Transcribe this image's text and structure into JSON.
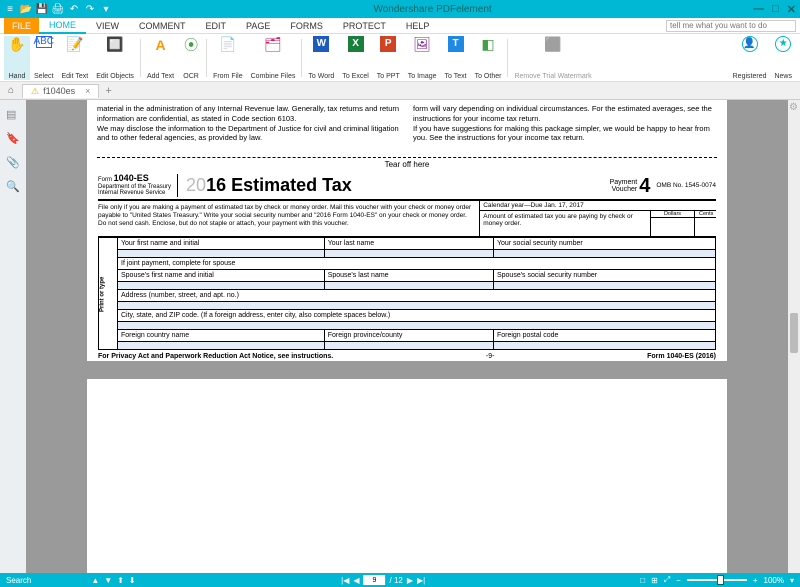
{
  "app": {
    "title": "Wondershare PDFelement"
  },
  "window": {
    "min": "—",
    "max": "□",
    "close": "✕"
  },
  "menu": {
    "file": "FILE",
    "items": [
      "HOME",
      "VIEW",
      "COMMENT",
      "EDIT",
      "PAGE",
      "FORMS",
      "PROTECT",
      "HELP"
    ],
    "active": "HOME",
    "search_placeholder": "tell me what you want to do"
  },
  "ribbon": {
    "groups": [
      {
        "icon": "✋",
        "label": "Hand",
        "color": "#00b8d4"
      },
      {
        "icon": "⬚",
        "label": "Select",
        "color": "#2962ff"
      },
      {
        "icon": "📝",
        "label": "Edit Text",
        "color": "#555"
      },
      {
        "icon": "🔲",
        "label": "Edit Objects",
        "color": "#555"
      }
    ],
    "groups2": [
      {
        "icon": "A",
        "label": "Add Text",
        "color": "#ff9800"
      },
      {
        "icon": "👁",
        "label": "OCR",
        "color": "#43a047"
      }
    ],
    "groups3": [
      {
        "icon": "📄",
        "label": "From File",
        "color": "#1e88e5"
      },
      {
        "icon": "🗂",
        "label": "Combine Files",
        "color": "#d81b60"
      }
    ],
    "groups4": [
      {
        "icon": "W",
        "label": "To Word",
        "color": "#1e5bbf"
      },
      {
        "icon": "X",
        "label": "To Excel",
        "color": "#1b7e3c"
      },
      {
        "icon": "P",
        "label": "To PPT",
        "color": "#d04423"
      },
      {
        "icon": "🖼",
        "label": "To Image",
        "color": "#7b1fa2"
      },
      {
        "icon": "T",
        "label": "To Text",
        "color": "#1e88e5"
      },
      {
        "icon": "⋯",
        "label": "To Other",
        "color": "#43a047"
      }
    ],
    "groups5": [
      {
        "icon": "⬛",
        "label": "Remove Trial Watermark",
        "color": "#bbb"
      }
    ],
    "right": [
      {
        "icon": "👤",
        "label": "Registered",
        "color": "#00b8d4"
      },
      {
        "icon": "★",
        "label": "News",
        "color": "#00b8d4"
      }
    ]
  },
  "tabs": {
    "home_icon": "⌂",
    "doc_icon": "⚠",
    "doc_name": "f1040es",
    "close": "×",
    "add": "+"
  },
  "doc": {
    "top_left": "material in the administration of any Internal Revenue law. Generally, tax returns and return information are confidential, as stated in Code section 6103.\n   We may disclose the information to the Department of Justice for civil and criminal litigation and to other federal agencies, as provided by law.",
    "top_right": "form will vary depending on individual circumstances. For the estimated averages, see the instructions for your income tax return.\n   If you have suggestions for making this package simpler, we would be happy to hear from you. See the instructions for your income tax return.",
    "tearoff": "Tear off here",
    "header": {
      "form_word": "Form",
      "form_no": "1040-ES",
      "dept": "Department of the Treasury",
      "irs": "Internal Revenue Service",
      "year_light": "20",
      "year_bold": "16",
      "title_rest": " Estimated Tax",
      "payment": "Payment",
      "voucher": "Voucher",
      "voucher_no": "4",
      "omb": "OMB No. 1545-0074"
    },
    "calendar": "Calendar year—Due Jan. 17, 2017",
    "instructions": "File only if you are making a payment of estimated tax by check or money order. Mail this voucher with your check or money order payable to \"United States Treasury.\" Write your social security number and \"2016 Form 1040-ES\" on your check or money order. Do not send cash. Enclose, but do not staple or attach, your payment with this voucher.",
    "amount_label": "Amount of estimated tax you are paying by check or money order.",
    "dollars": "Dollars",
    "cents": "Cents",
    "side": "Print or type",
    "rows": {
      "r1a": "Your first name and initial",
      "r1b": "Your last name",
      "r1c": "Your social security number",
      "r2": "If joint payment, complete for spouse",
      "r3a": "Spouse's first name and initial",
      "r3b": "Spouse's last name",
      "r3c": "Spouse's social security number",
      "r4": "Address (number, street, and apt. no.)",
      "r5": "City, state, and ZIP code. (If a foreign address, enter city, also complete spaces below.)",
      "r6a": "Foreign country name",
      "r6b": "Foreign province/county",
      "r6c": "Foreign postal code"
    },
    "footer_left": "For Privacy Act and Paperwork Reduction Act Notice, see instructions.",
    "footer_mid": "-9-",
    "footer_right": "Form 1040-ES (2016)"
  },
  "status": {
    "left": "Search",
    "nav_icons": [
      "▲",
      "▼",
      "⬆",
      "⬇"
    ],
    "first": "|◀",
    "prev": "◀",
    "page": "9",
    "total": "/ 12",
    "next": "▶",
    "last": "▶|",
    "view_icons": [
      "□",
      "⊞",
      "⤢"
    ],
    "zoom_minus": "−",
    "zoom_plus": "+",
    "zoom": "100%",
    "menu": "▾"
  }
}
